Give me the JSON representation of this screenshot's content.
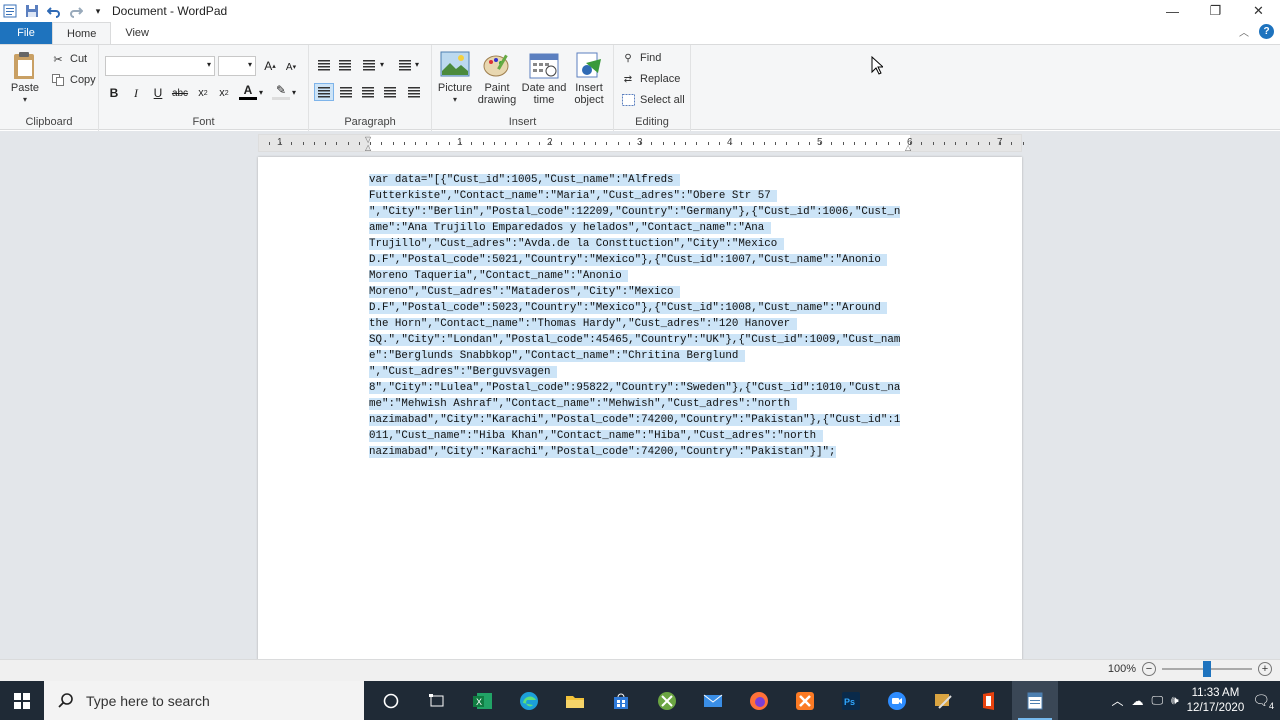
{
  "window": {
    "title": "Document - WordPad",
    "controls": [
      "minimize",
      "restore",
      "close"
    ]
  },
  "tabs": {
    "file": "File",
    "home": "Home",
    "view": "View"
  },
  "ribbon": {
    "clipboard": {
      "label": "Clipboard",
      "paste": "Paste",
      "cut": "Cut",
      "copy": "Copy"
    },
    "font": {
      "label": "Font",
      "family_value": "",
      "size_value": ""
    },
    "paragraph": {
      "label": "Paragraph"
    },
    "insert": {
      "label": "Insert",
      "picture": "Picture",
      "paint_drawing_1": "Paint",
      "paint_drawing_2": "drawing",
      "date_time_1": "Date and",
      "date_time_2": "time",
      "insert_object_1": "Insert",
      "insert_object_2": "object"
    },
    "editing": {
      "label": "Editing",
      "find": "Find",
      "replace": "Replace",
      "select_all": "Select all"
    }
  },
  "ruler": {
    "numbers": [
      "1",
      "1",
      "2",
      "3",
      "4",
      "5",
      "6",
      "7"
    ]
  },
  "document": {
    "lines": [
      "var data=\"[{\"Cust_id\":1005,\"Cust_name\":\"Alfreds ",
      "Futterkiste\",\"Contact_name\":\"Maria\",\"Cust_adres\":\"Obere Str 57 ",
      "\",\"City\":\"Berlin\",\"Postal_code\":12209,\"Country\":\"Germany\"},{\"Cust_id\":1006,\"Cust_n",
      "ame\":\"Ana Trujillo Emparedados y helados\",\"Contact_name\":\"Ana ",
      "Trujillo\",\"Cust_adres\":\"Avda.de la Consttuction\",\"City\":\"Mexico ",
      "D.F\",\"Postal_code\":5021,\"Country\":\"Mexico\"},{\"Cust_id\":1007,\"Cust_name\":\"Anonio ",
      "Moreno Taqueria\",\"Contact_name\":\"Anonio ",
      "Moreno\",\"Cust_adres\":\"Mataderos\",\"City\":\"Mexico ",
      "D.F\",\"Postal_code\":5023,\"Country\":\"Mexico\"},{\"Cust_id\":1008,\"Cust_name\":\"Around ",
      "the Horn\",\"Contact_name\":\"Thomas Hardy\",\"Cust_adres\":\"120 Hanover ",
      "SQ.\",\"City\":\"Londan\",\"Postal_code\":45465,\"Country\":\"UK\"},{\"Cust_id\":1009,\"Cust_nam",
      "e\":\"Berglunds Snabbkop\",\"Contact_name\":\"Chritina Berglund ",
      "\",\"Cust_adres\":\"Berguvsvagen ",
      "8\",\"City\":\"Lulea\",\"Postal_code\":95822,\"Country\":\"Sweden\"},{\"Cust_id\":1010,\"Cust_na",
      "me\":\"Mehwish Ashraf\",\"Contact_name\":\"Mehwish\",\"Cust_adres\":\"north ",
      "nazimabad\",\"City\":\"Karachi\",\"Postal_code\":74200,\"Country\":\"Pakistan\"},{\"Cust_id\":1",
      "011,\"Cust_name\":\"Hiba Khan\",\"Contact_name\":\"Hiba\",\"Cust_adres\":\"north ",
      "nazimabad\",\"City\":\"Karachi\",\"Postal_code\":74200,\"Country\":\"Pakistan\"}]\";"
    ]
  },
  "status": {
    "zoom": "100%",
    "zoom_level": 0.5
  },
  "taskbar": {
    "search_placeholder": "Type here to search",
    "time": "11:33 AM",
    "date": "12/17/2020",
    "notification_count": "4"
  },
  "colors": {
    "accent": "#1e73be",
    "selection": "#cce4f7",
    "taskbar": "#1f2a36"
  }
}
